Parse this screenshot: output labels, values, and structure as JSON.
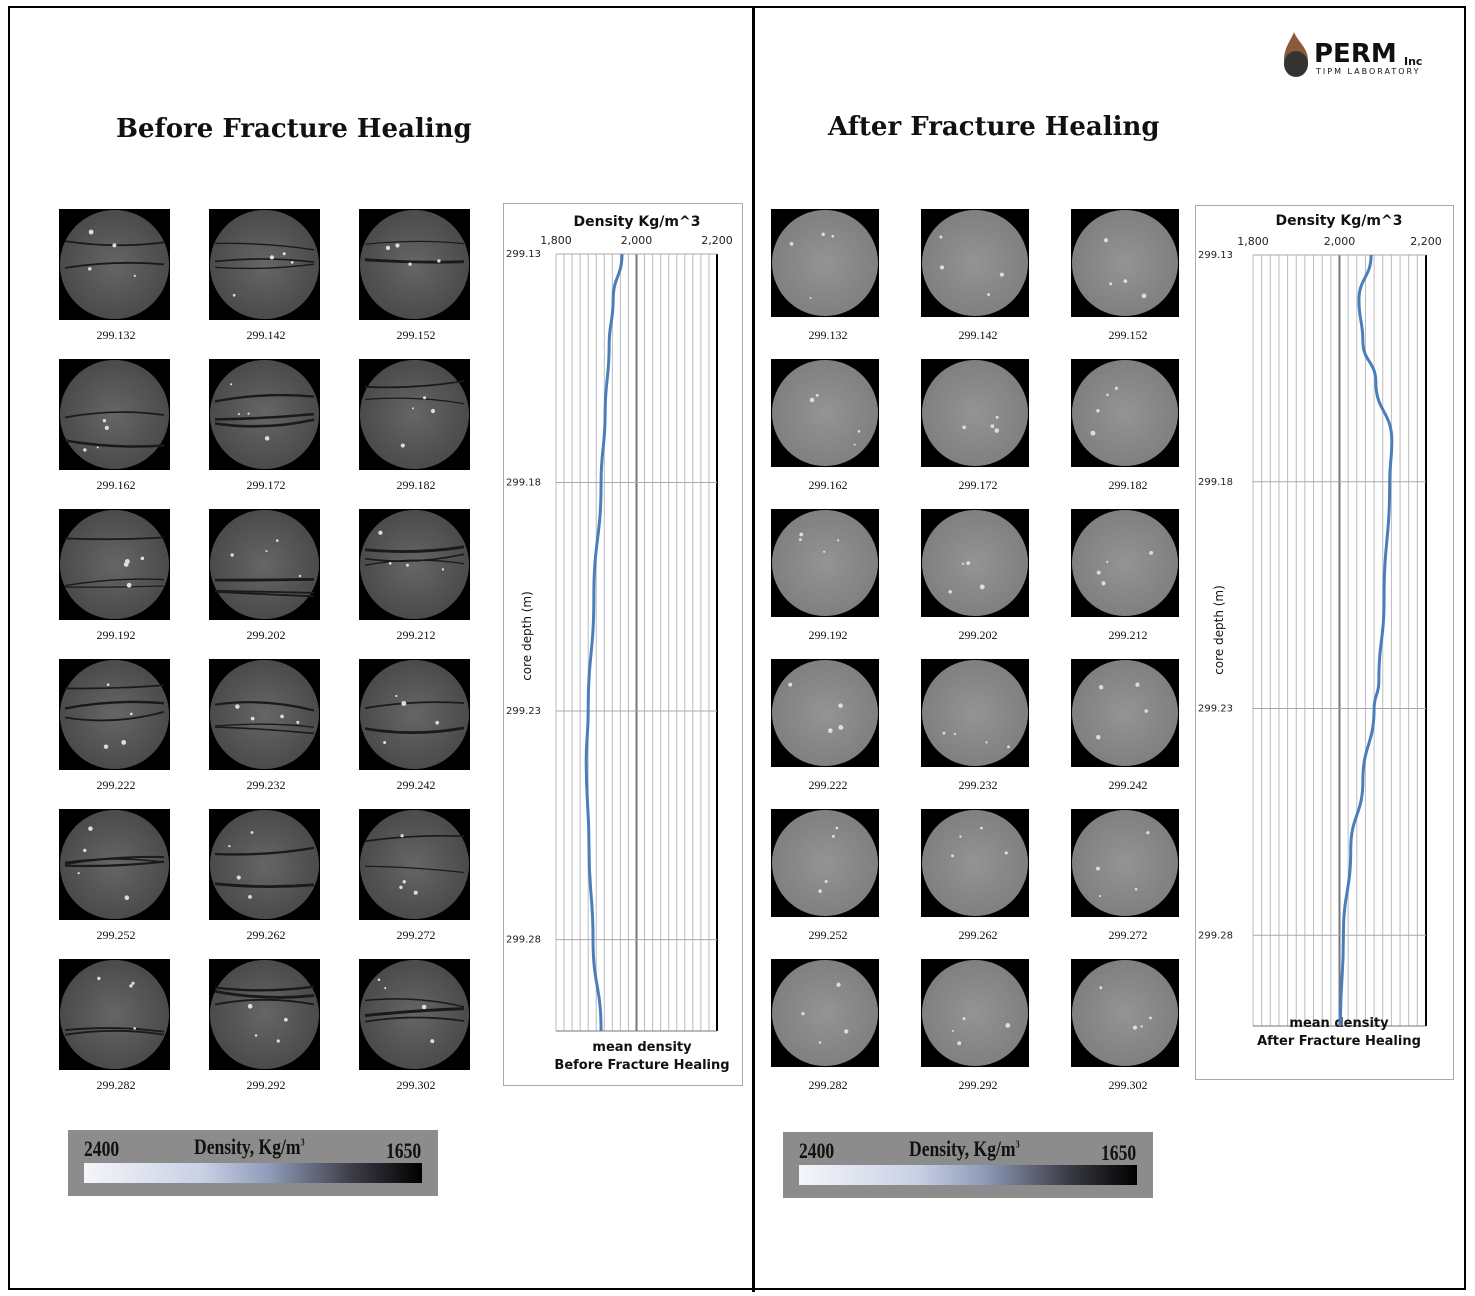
{
  "logo": {
    "name": "PERM",
    "suffix": "Inc",
    "sub": "TIPM LABORATORY"
  },
  "panels": [
    {
      "title": "Before Fracture Healing",
      "images": [
        "299.132",
        "299.142",
        "299.152",
        "299.162",
        "299.172",
        "299.182",
        "299.192",
        "299.202",
        "299.212",
        "299.222",
        "299.232",
        "299.242",
        "299.252",
        "299.262",
        "299.272",
        "299.282",
        "299.292",
        "299.302"
      ],
      "colorbar": {
        "max": "2400",
        "label": "Density, Kg/m",
        "sup": "3",
        "min": "1650"
      }
    },
    {
      "title": "After Fracture Healing",
      "images": [
        "299.132",
        "299.142",
        "299.152",
        "299.162",
        "299.172",
        "299.182",
        "299.192",
        "299.202",
        "299.212",
        "299.222",
        "299.232",
        "299.242",
        "299.252",
        "299.262",
        "299.272",
        "299.282",
        "299.292",
        "299.302"
      ],
      "colorbar": {
        "max": "2400",
        "label": "Density, Kg/m",
        "sup": "3",
        "min": "1650"
      }
    }
  ],
  "chart_data": [
    {
      "type": "line",
      "title": "Density Kg/m^3",
      "xlabel": "mean density",
      "xlabel2": "Before Fracture Healing",
      "ylabel": "core depth (m)",
      "xlim": [
        1800,
        2200
      ],
      "ylim": [
        299.13,
        299.3
      ],
      "y_inverted": true,
      "x_ticks": [
        "1,800",
        "2,000",
        "2,200"
      ],
      "y_ticks": [
        "299.13",
        "299.18",
        "299.23",
        "299.28"
      ],
      "grid": true,
      "color": "#4a7ebb",
      "points": [
        [
          1964,
          299.13
        ],
        [
          1942,
          299.14
        ],
        [
          1932,
          299.15
        ],
        [
          1922,
          299.165
        ],
        [
          1912,
          299.18
        ],
        [
          1894,
          299.205
        ],
        [
          1880,
          299.23
        ],
        [
          1875,
          299.241
        ],
        [
          1882,
          299.26
        ],
        [
          1892,
          299.28
        ],
        [
          1912,
          299.3
        ]
      ]
    },
    {
      "type": "line",
      "title": "Density Kg/m^3",
      "xlabel": "mean density",
      "xlabel2": "After Fracture Healing",
      "ylabel": "core depth (m)",
      "xlim": [
        1800,
        2200
      ],
      "ylim": [
        299.13,
        299.3
      ],
      "y_inverted": true,
      "x_ticks": [
        "1,800",
        "2,000",
        "2,200"
      ],
      "y_ticks": [
        "299.13",
        "299.18",
        "299.23",
        "299.28"
      ],
      "grid": true,
      "color": "#4a7ebb",
      "points": [
        [
          2073,
          299.13
        ],
        [
          2045,
          299.14
        ],
        [
          2054,
          299.149
        ],
        [
          2084,
          299.158
        ],
        [
          2121,
          299.171
        ],
        [
          2116,
          299.18
        ],
        [
          2103,
          299.206
        ],
        [
          2091,
          299.224
        ],
        [
          2080,
          299.23
        ],
        [
          2054,
          299.246
        ],
        [
          2026,
          299.261
        ],
        [
          2009,
          299.28
        ],
        [
          2002,
          299.3
        ]
      ]
    }
  ]
}
